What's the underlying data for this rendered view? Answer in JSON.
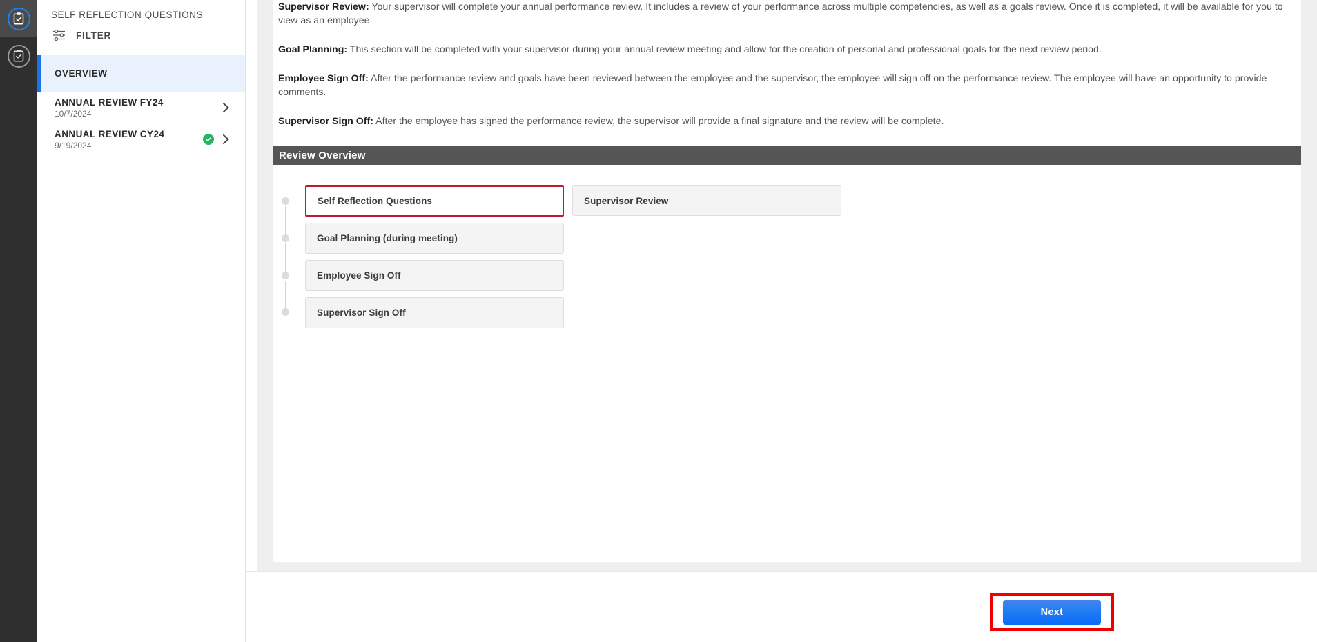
{
  "rail": {
    "items": [
      {
        "name": "clipboard-check-active",
        "icon": "clipboard-check-icon",
        "active": true
      },
      {
        "name": "clipboard-check-secondary",
        "icon": "clipboard-check-icon",
        "active": false
      }
    ]
  },
  "sidebar": {
    "title": "SELF REFLECTION QUESTIONS",
    "filter_label": "FILTER",
    "filter_icon": "tune-slider-icon",
    "items": [
      {
        "label": "OVERVIEW",
        "selected": true,
        "date": "",
        "completed": false
      },
      {
        "label": "ANNUAL REVIEW FY24",
        "date": "10/7/2024",
        "selected": false,
        "completed": false,
        "chevron_icon": "chevron-right-icon"
      },
      {
        "label": "ANNUAL REVIEW CY24",
        "date": "9/19/2024",
        "selected": false,
        "completed": true,
        "status_icon": "check-circle-icon",
        "chevron_icon": "chevron-right-icon"
      }
    ]
  },
  "main": {
    "paragraphs": [
      {
        "term": "Supervisor Review:",
        "body": " Your supervisor will complete your annual performance review.  It includes a review of your performance across multiple competencies, as well as a goals review.  Once it is completed, it will be available for you to view as an employee."
      },
      {
        "term": "Goal Planning:",
        "body": "  This section will be completed with your supervisor during your annual review meeting and allow for the creation of personal and professional goals for the next review period."
      },
      {
        "term": "Employee Sign Off:",
        "body": "  After the performance review and goals have been reviewed between the employee and the supervisor, the employee will sign off on the performance review.  The employee will have an opportunity to provide comments."
      },
      {
        "term": "Supervisor Sign Off:",
        "body": "  After the employee has signed the performance review, the supervisor will provide a final signature and the review will be complete."
      }
    ],
    "overview_band_title": "Review Overview",
    "steps_primary": [
      {
        "label": "Self Reflection Questions",
        "current": true
      },
      {
        "label": "Goal Planning (during meeting)",
        "current": false
      },
      {
        "label": "Employee Sign Off",
        "current": false
      },
      {
        "label": "Supervisor Sign Off",
        "current": false
      }
    ],
    "steps_secondary": [
      {
        "label": "Supervisor Review",
        "current": false
      }
    ]
  },
  "footer": {
    "next_label": "Next"
  },
  "colors": {
    "accent_blue": "#1872e8",
    "rail_bg": "#2f2f2f",
    "band_gray": "#555555",
    "success_green": "#25b45f",
    "annotation_red": "#ee0000",
    "current_step_red": "#c4182c",
    "selected_nav_bg": "#e9f1fd"
  }
}
